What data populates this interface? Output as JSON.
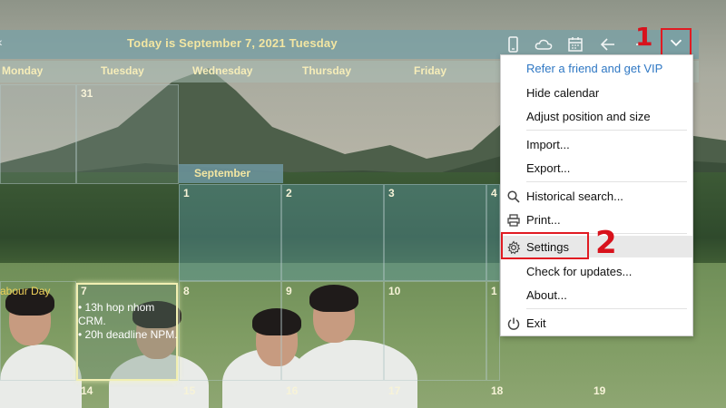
{
  "header": {
    "today_text": "Today is September 7, 2021 Tuesday"
  },
  "toolbar": {
    "icons": [
      "phone-icon",
      "cloud-icon",
      "calendar-icon",
      "back-arrow-icon",
      "minimize-icon",
      "chevron-down-icon"
    ]
  },
  "annotations": {
    "step1": "1",
    "step2": "2"
  },
  "colors": {
    "highlight_red": "#e11b22",
    "accent_gold": "#f3e6a2",
    "vip_blue": "#2f78c4"
  },
  "weekdays": [
    "Monday",
    "Tuesday",
    "Wednesday",
    "Thursday",
    "Friday"
  ],
  "calendar": {
    "month_label": "September",
    "days": {
      "d31": "31",
      "d1": "1",
      "d2": "2",
      "d3": "3",
      "d4": "4",
      "d7": "7",
      "d8": "8",
      "d9": "9",
      "d10": "10",
      "d11": "1",
      "d14": "14",
      "d15": "15",
      "d16": "16",
      "d17": "17",
      "d18": "18",
      "d19": "19"
    },
    "holiday": "abour Day",
    "events": [
      "• 13h hop nhom CRM.",
      "• 20h deadline NPM."
    ]
  },
  "menu": {
    "items": [
      "Refer a friend and get VIP",
      "Hide calendar",
      "Adjust position and size",
      "Import...",
      "Export...",
      "Historical search...",
      "Print...",
      "Settings",
      "Check for updates...",
      "About...",
      "Exit"
    ]
  }
}
